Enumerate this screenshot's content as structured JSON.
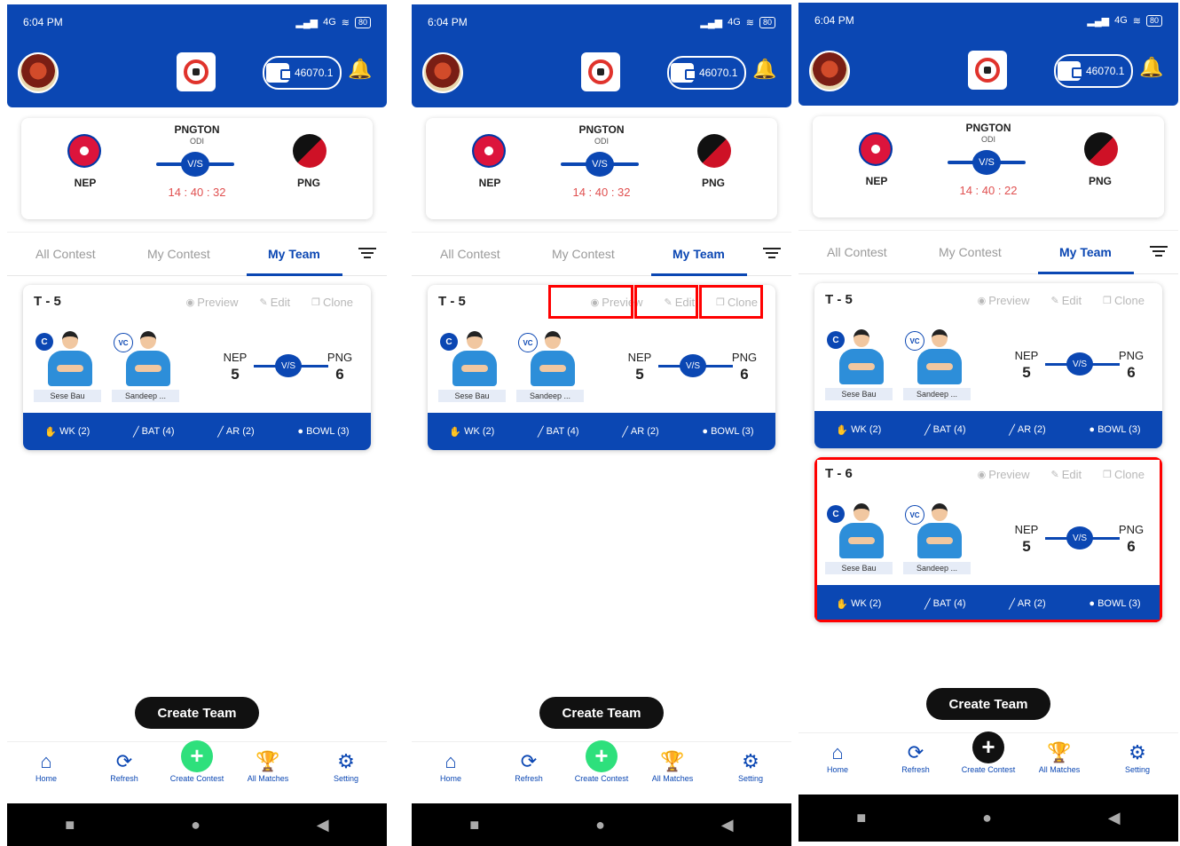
{
  "status": {
    "time": "6:04 PM",
    "signal": "4G",
    "battery": "80"
  },
  "header": {
    "wallet_balance": "46070.1"
  },
  "match": {
    "title": "PNGTON",
    "format": "ODI",
    "team1": "NEP",
    "team2": "PNG",
    "vs": "V/S"
  },
  "tabs": [
    "All Contest",
    "My Contest",
    "My Team"
  ],
  "actions": {
    "preview": "Preview",
    "edit": "Edit",
    "clone": "Clone"
  },
  "captain_badge": "C",
  "vice_captain_badge": "VC",
  "roles": [
    "WK (2)",
    "BAT (4)",
    "AR (2)",
    "BOWL (3)"
  ],
  "players": {
    "captain": "Sese Bau",
    "vice_captain": "Sandeep ..."
  },
  "teams": [
    {
      "name": "T - 5",
      "nep_count": "5",
      "png_count": "6"
    },
    {
      "name": "T - 6",
      "nep_count": "5",
      "png_count": "6"
    }
  ],
  "screens": [
    {
      "timer": "14 : 40 : 32"
    },
    {
      "timer": "14 : 40 : 32"
    },
    {
      "timer": "14 : 40 : 22"
    }
  ],
  "create_team_label": "Create Team",
  "nav": [
    "Home",
    "Refresh",
    "Create Contest",
    "All Matches",
    "Setting"
  ],
  "colors": {
    "primary": "#0b47b3",
    "highlight": "#ff0000",
    "fab_green": "#2ee07c"
  }
}
